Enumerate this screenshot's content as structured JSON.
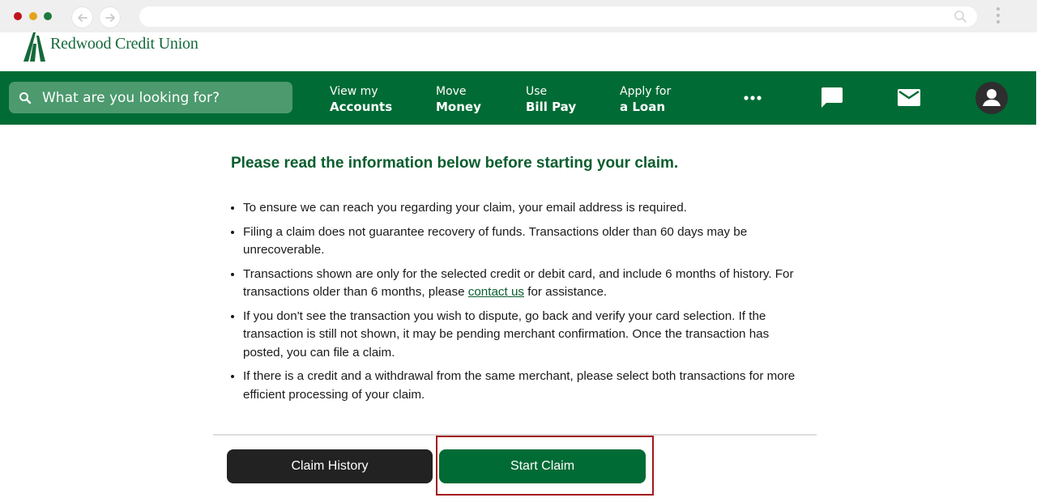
{
  "browser": {
    "back_icon": "arrow-left-icon",
    "forward_icon": "arrow-right-icon",
    "search_icon": "search-icon",
    "menu_icon": "kebab-icon"
  },
  "logo": {
    "text": "Redwood Credit Union"
  },
  "nav": {
    "search_placeholder": "What are you looking for?",
    "links": [
      {
        "line1": "View my",
        "line2": "Accounts"
      },
      {
        "line1": "Move",
        "line2": "Money"
      },
      {
        "line1": "Use",
        "line2": "Bill Pay"
      },
      {
        "line1": "Apply for",
        "line2": "a Loan"
      }
    ],
    "icons": [
      "more-icon",
      "chat-icon",
      "mail-icon",
      "user-avatar-icon"
    ]
  },
  "content": {
    "heading": "Please read the information below before starting your claim.",
    "bullets": [
      {
        "text": "To ensure we can reach you regarding your claim, your email address is required."
      },
      {
        "text": "Filing a claim does not guarantee recovery of funds. Transactions older than 60 days may be unrecoverable."
      },
      {
        "pre": "Transactions shown are only for the selected credit or debit card, and include 6 months of history. For transactions older than 6 months, please ",
        "link": "contact us",
        "post": " for assistance."
      },
      {
        "text": "If you don't see the transaction you wish to dispute, go back and verify your card selection. If the transaction is still not shown, it may be pending merchant confirmation. Once the transaction has posted, you can file a claim."
      },
      {
        "text": "If there is a credit and a withdrawal from the same merchant, please select both transactions for more efficient processing of your claim."
      }
    ]
  },
  "buttons": {
    "history": "Claim History",
    "start": "Start Claim"
  },
  "colors": {
    "brand_green": "#006b35",
    "heading_green": "#0b5e2f",
    "highlight": "#a3171d"
  }
}
